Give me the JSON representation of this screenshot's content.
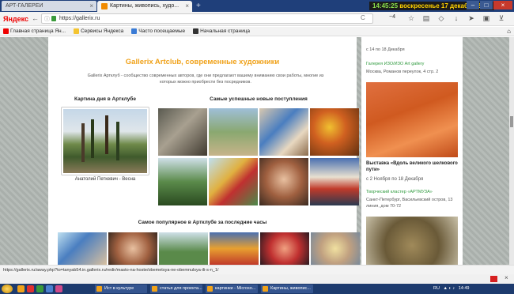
{
  "browser": {
    "tabs": [
      {
        "label": "АРТ-ГАЛЕРЕИ",
        "active": false
      },
      {
        "label": "Картины, живопись, худо...",
        "active": true
      }
    ],
    "clock": "14:45:25",
    "date": "воскресенье 17 декабря 2017",
    "logo": "Яндекс",
    "url": "https://gallerix.ru",
    "weather": "−4",
    "bookmarks": [
      {
        "label": "Главная страница Ян...",
        "icon": "yandex-icon"
      },
      {
        "label": "Сервисы Яндекса",
        "icon": "folder-icon"
      },
      {
        "label": "Часто посещаемые",
        "icon": "star-icon"
      },
      {
        "label": "Начальная страница",
        "icon": "grid-icon"
      }
    ]
  },
  "page": {
    "title": "Gallerix Artclub, современные художники",
    "description": "Gallerix Артклуб - сообщество современных авторов, где они предлагают вашему вниманию свои работы, многие из которых можно приобрести без посредников.",
    "picture_of_day": {
      "heading": "Картина дня в Артклубе",
      "caption": "Анатолий Петкевич - Весна"
    },
    "new_arrivals": {
      "heading": "Самые успешные новые поступления"
    },
    "popular": {
      "heading": "Самое популярное в Артклубе за последние часы"
    }
  },
  "sidebar": {
    "date1": "с 14 по 18 Декабря",
    "gallery": "Галерея ИЗО/ИЗО Art gallery",
    "address1": "Москва, Романов переулок, 4 стр. 2",
    "exhibition_title": "Выставка «Вдоль великого шелкового пути»",
    "date2": "с 2 Ноября по 18 Декабря",
    "cluster": "Творческий кластер «АРТМУЗА»",
    "address2": "Санкт-Петербург, Васильевский остров, 13 линия, дом 70-72"
  },
  "status": {
    "url": "https://gallerix.ru/away.php?to=tanyab54.in.gallerix.ru/redir/masto-na-hoste/obemetsya-ne-obemnulsya-ili-s-n_1/"
  },
  "taskbar": {
    "tasks": [
      "Ист в культуре",
      "статья для проекта...",
      "картинки - Microso...",
      "Картины, живопис..."
    ],
    "lang": "RU",
    "time": "14:49"
  }
}
